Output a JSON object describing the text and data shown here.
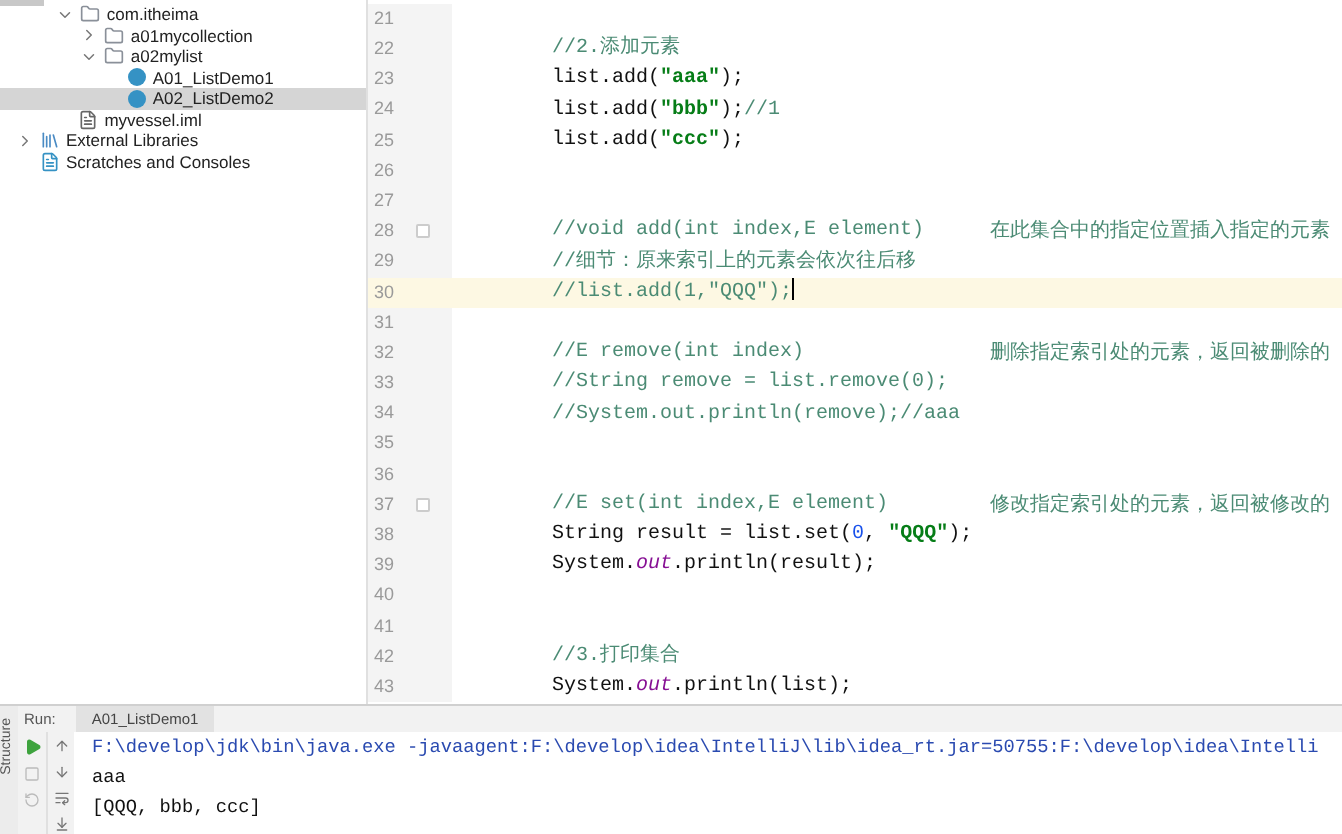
{
  "project_tree": {
    "module_items": [
      {
        "label": "com.itheima",
        "kind": "folder",
        "expanded": true,
        "selected": false,
        "children": [
          {
            "label": "a01mycollection",
            "kind": "folder",
            "expanded": false,
            "selected": false
          },
          {
            "label": "a02mylist",
            "kind": "folder",
            "expanded": true,
            "selected": false,
            "children": [
              {
                "label": "A01_ListDemo1",
                "kind": "class",
                "selected": false
              },
              {
                "label": "A02_ListDemo2",
                "kind": "class",
                "selected": true
              }
            ]
          }
        ]
      },
      {
        "label": "myvessel.iml",
        "kind": "file",
        "selected": false
      }
    ],
    "root_items": [
      {
        "label": "External Libraries",
        "kind": "library",
        "expanded": false,
        "selected": false
      },
      {
        "label": "Scratches and Consoles",
        "kind": "scratch",
        "selected": false
      }
    ]
  },
  "editor": {
    "lines": [
      {
        "number": "21",
        "current": false
      },
      {
        "number": "22",
        "current": false,
        "segments": [
          {
            "kind": "comment",
            "text": "//2.添加元素"
          }
        ]
      },
      {
        "number": "23",
        "current": false,
        "segments": [
          {
            "kind": "code",
            "text": "list.add("
          },
          {
            "kind": "string",
            "text": "\"aaa\""
          },
          {
            "kind": "code",
            "text": ");"
          }
        ]
      },
      {
        "number": "24",
        "current": false,
        "segments": [
          {
            "kind": "code",
            "text": "list.add("
          },
          {
            "kind": "string",
            "text": "\"bbb\""
          },
          {
            "kind": "code",
            "text": ");"
          },
          {
            "kind": "comment",
            "text": "//1"
          }
        ]
      },
      {
        "number": "25",
        "current": false,
        "segments": [
          {
            "kind": "code",
            "text": "list.add("
          },
          {
            "kind": "string",
            "text": "\"ccc\""
          },
          {
            "kind": "code",
            "text": ");"
          }
        ]
      },
      {
        "number": "26",
        "current": false
      },
      {
        "number": "27",
        "current": false
      },
      {
        "number": "28",
        "current": false,
        "fold": true,
        "segments": [
          {
            "kind": "comment",
            "text": "//void add(int index,E element)"
          }
        ],
        "aside": "在此集合中的指定位置插入指定的元素"
      },
      {
        "number": "29",
        "current": false,
        "segments": [
          {
            "kind": "comment",
            "text": "//细节：原来索引上的元素会依次往后移"
          }
        ]
      },
      {
        "number": "30",
        "current": true,
        "segments": [
          {
            "kind": "comment",
            "text": "//list.add(1,\"QQQ\");"
          }
        ]
      },
      {
        "number": "31",
        "current": false
      },
      {
        "number": "32",
        "current": false,
        "segments": [
          {
            "kind": "comment",
            "text": "//E remove(int index)"
          }
        ],
        "aside": "删除指定索引处的元素，返回被删除的"
      },
      {
        "number": "33",
        "current": false,
        "segments": [
          {
            "kind": "comment",
            "text": "//String remove = list.remove(0);"
          }
        ]
      },
      {
        "number": "34",
        "current": false,
        "segments": [
          {
            "kind": "comment",
            "text": "//System.out.println(remove);//aaa"
          }
        ]
      },
      {
        "number": "35",
        "current": false
      },
      {
        "number": "36",
        "current": false
      },
      {
        "number": "37",
        "current": false,
        "fold": true,
        "segments": [
          {
            "kind": "comment",
            "text": "//E set(int index,E element)"
          }
        ],
        "aside": "修改指定索引处的元素，返回被修改的"
      },
      {
        "number": "38",
        "current": false,
        "segments": [
          {
            "kind": "code",
            "text": "String result = list.set("
          },
          {
            "kind": "number",
            "text": "0"
          },
          {
            "kind": "code",
            "text": ", "
          },
          {
            "kind": "string",
            "text": "\"QQQ\""
          },
          {
            "kind": "code",
            "text": ");"
          }
        ]
      },
      {
        "number": "39",
        "current": false,
        "segments": [
          {
            "kind": "code",
            "text": "System."
          },
          {
            "kind": "field",
            "text": "out"
          },
          {
            "kind": "code",
            "text": ".println(result);"
          }
        ]
      },
      {
        "number": "40",
        "current": false
      },
      {
        "number": "41",
        "current": false
      },
      {
        "number": "42",
        "current": false,
        "segments": [
          {
            "kind": "comment",
            "text": "//3.打印集合"
          }
        ]
      },
      {
        "number": "43",
        "current": false,
        "segments": [
          {
            "kind": "code",
            "text": "System."
          },
          {
            "kind": "field",
            "text": "out"
          },
          {
            "kind": "code",
            "text": ".println(list);"
          }
        ]
      }
    ]
  },
  "run_panel": {
    "label": "Run:",
    "tab": "A01_ListDemo1",
    "side_tab": "Structure",
    "output": [
      {
        "kind": "command",
        "text": "F:\\develop\\jdk\\bin\\java.exe -javaagent:F:\\develop\\idea\\IntelliJ\\lib\\idea_rt.jar=50755:F:\\develop\\idea\\Intelli"
      },
      {
        "kind": "stdout",
        "text": "aaa"
      },
      {
        "kind": "stdout",
        "text": "[QQQ, bbb, ccc]"
      }
    ]
  }
}
